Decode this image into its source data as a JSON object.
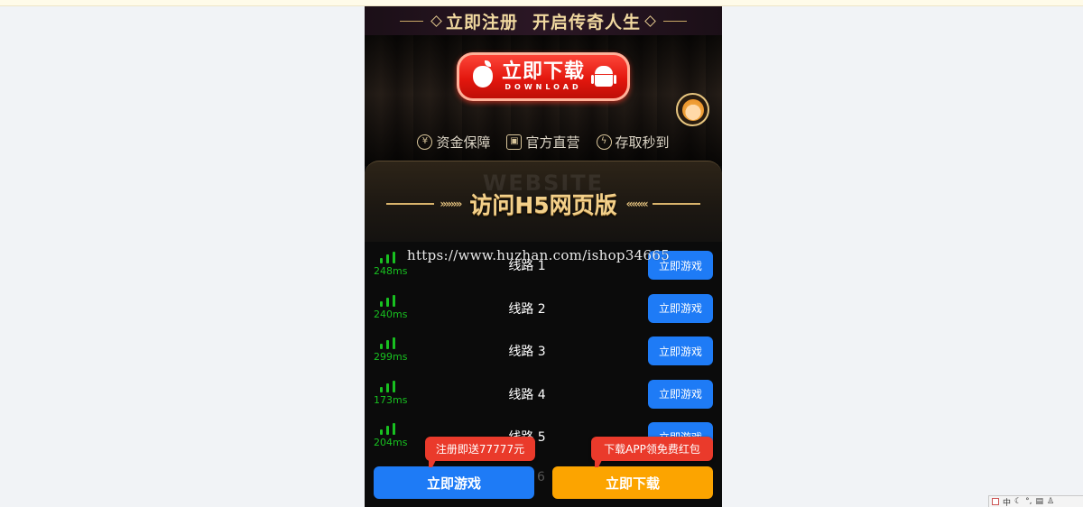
{
  "banner": {
    "left_text": "立即注册",
    "right_text": "开启传奇人生"
  },
  "hero": {
    "download_label": "立即下载",
    "download_sublabel": "DOWNLOAD",
    "features": [
      {
        "icon": "yen-coin-icon",
        "glyph": "¥",
        "label": "资金保障"
      },
      {
        "icon": "official-card-icon",
        "glyph": "▣",
        "label": "官方直营"
      },
      {
        "icon": "lightning-icon",
        "glyph": "ϟ",
        "label": "存取秒到"
      }
    ]
  },
  "h5": {
    "title": "访问H5网页版",
    "ghost_text": "WEBSITE"
  },
  "watermark": "https://www.huzhan.com/ishop34665",
  "routes": [
    {
      "latency": "248ms",
      "name": "线路 1",
      "action": "立即游戏"
    },
    {
      "latency": "240ms",
      "name": "线路 2",
      "action": "立即游戏"
    },
    {
      "latency": "299ms",
      "name": "线路 3",
      "action": "立即游戏"
    },
    {
      "latency": "173ms",
      "name": "线路 4",
      "action": "立即游戏"
    },
    {
      "latency": "204ms",
      "name": "线路 5",
      "action": "立即游戏"
    }
  ],
  "route6_hint": "6",
  "bottom": {
    "play_label": "立即游戏",
    "download_label": "立即下载",
    "play_tip": "注册即送77777元",
    "download_tip": "下载APP领免费红包"
  },
  "tray": {
    "label": "中"
  },
  "colors": {
    "accent_blue": "#1e7bf6",
    "accent_orange": "#fca400",
    "tip_red": "#ea3a2b",
    "signal_green": "#18c020",
    "gold": "#f3d08a"
  }
}
